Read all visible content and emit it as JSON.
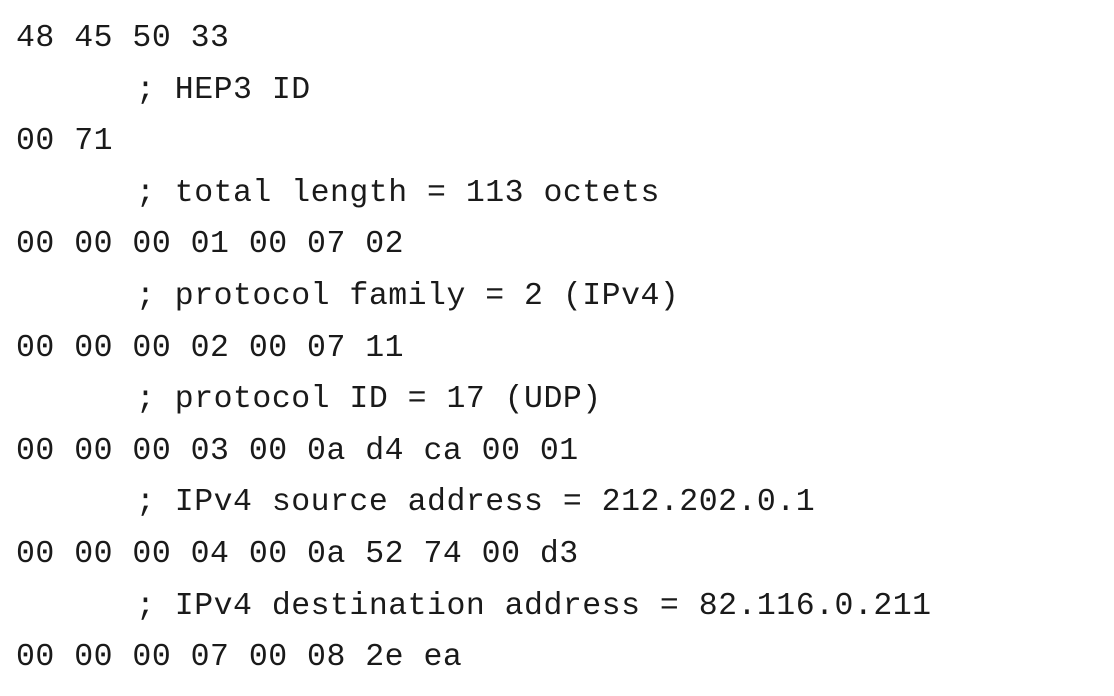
{
  "document": {
    "entries": [
      {
        "bytes": "48 45 50 33",
        "comment": "; HEP3 ID"
      },
      {
        "bytes": "00 71",
        "comment": "; total length = 113 octets"
      },
      {
        "bytes": "00 00 00 01 00 07 02",
        "comment": "; protocol family = 2 (IPv4)"
      },
      {
        "bytes": "00 00 00 02 00 07 11",
        "comment": "; protocol ID = 17 (UDP)"
      },
      {
        "bytes": "00 00 00 03 00 0a d4 ca 00 01",
        "comment": "; IPv4 source address = 212.202.0.1"
      },
      {
        "bytes": "00 00 00 04 00 0a 52 74 00 d3",
        "comment": "; IPv4 destination address = 82.116.0.211"
      },
      {
        "bytes": "00 00 00 07 00 08 2e ea"
      }
    ]
  }
}
